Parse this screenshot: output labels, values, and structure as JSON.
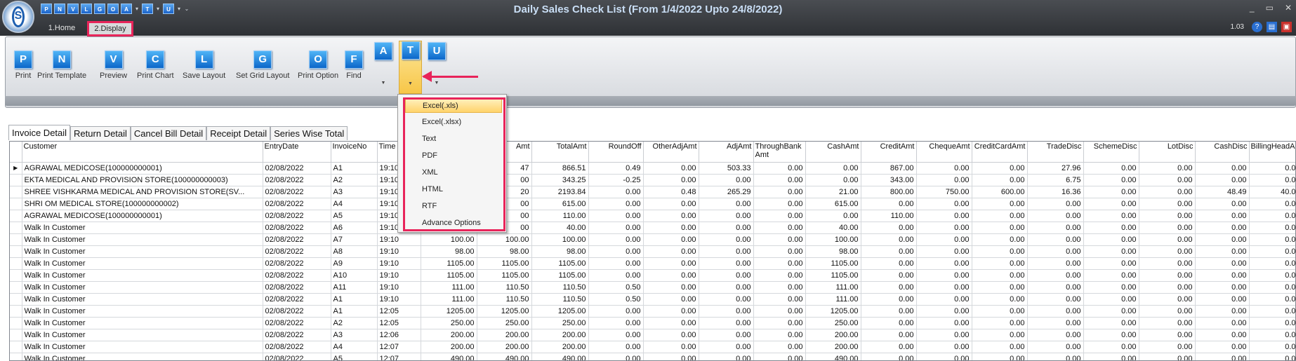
{
  "window": {
    "title": "Daily Sales Check List (From 1/4/2022 Upto 24/8/2022)",
    "version": "1.03",
    "controls": [
      "_",
      "▭",
      "✕"
    ]
  },
  "quick_access": [
    "P",
    "N",
    "V",
    "L",
    "G",
    "O",
    "A",
    "T",
    "U"
  ],
  "ribbon_tabs": [
    {
      "label": "1.Home"
    },
    {
      "label": "2.Display"
    }
  ],
  "ribbon_buttons": [
    {
      "glyph": "P",
      "label": "Print"
    },
    {
      "glyph": "N",
      "label": "Print Template"
    },
    {
      "glyph": "V",
      "label": "Preview"
    },
    {
      "glyph": "C",
      "label": "Print Chart"
    },
    {
      "glyph": "L",
      "label": "Save Layout"
    },
    {
      "glyph": "G",
      "label": "Set Grid Layout"
    },
    {
      "glyph": "O",
      "label": "Print Option"
    },
    {
      "glyph": "F",
      "label": "Find"
    }
  ],
  "split_buttons": [
    {
      "glyph": "A"
    },
    {
      "glyph": "T"
    },
    {
      "glyph": "U"
    }
  ],
  "export_menu": {
    "items": [
      "Excel(.xls)",
      "Excel(.xlsx)",
      "Text",
      "PDF",
      "XML",
      "HTML",
      "RTF",
      "Advance Options"
    ],
    "active": "Excel(.xls)"
  },
  "detail_tabs": [
    "Invoice Detail",
    "Return Detail",
    "Cancel Bill Detail",
    "Receipt Detail",
    "Series Wise Total"
  ],
  "columns": [
    "",
    "Customer",
    "EntryDate",
    "InvoiceNo",
    "Time",
    "",
    "Amt",
    "TotalAmt",
    "RoundOff",
    "OtherAdjAmt",
    "AdjAmt",
    "ThroughBank Amt",
    "CashAmt",
    "CreditAmt",
    "ChequeAmt",
    "CreditCardAmt",
    "TradeDisc",
    "SchemeDisc",
    "LotDisc",
    "CashDisc",
    "BillingHeadAr"
  ],
  "rows": [
    [
      "▶",
      "AGRAWAL MEDICOSE(100000000001)",
      "02/08/2022",
      "A1",
      "19:10",
      "",
      "47",
      "866.51",
      "0.49",
      "0.00",
      "503.33",
      "0.00",
      "0.00",
      "867.00",
      "0.00",
      "0.00",
      "27.96",
      "0.00",
      "0.00",
      "0.00",
      "0.0"
    ],
    [
      "",
      "EKTA MEDICAL AND PROVISION STORE(100000000003)",
      "02/08/2022",
      "A2",
      "19:10",
      "",
      "00",
      "343.25",
      "-0.25",
      "0.00",
      "0.00",
      "0.00",
      "0.00",
      "343.00",
      "0.00",
      "0.00",
      "6.75",
      "0.00",
      "0.00",
      "0.00",
      "0.0"
    ],
    [
      "",
      "SHREE VISHKARMA MEDICAL AND PROVISION STORE(SV...",
      "02/08/2022",
      "A3",
      "19:10",
      "",
      "20",
      "2193.84",
      "0.00",
      "0.48",
      "265.29",
      "0.00",
      "21.00",
      "800.00",
      "750.00",
      "600.00",
      "16.36",
      "0.00",
      "0.00",
      "48.49",
      "40.0"
    ],
    [
      "",
      "SHRI OM MEDICAL STORE(100000000002)",
      "02/08/2022",
      "A4",
      "19:10",
      "",
      "00",
      "615.00",
      "0.00",
      "0.00",
      "0.00",
      "0.00",
      "615.00",
      "0.00",
      "0.00",
      "0.00",
      "0.00",
      "0.00",
      "0.00",
      "0.00",
      "0.0"
    ],
    [
      "",
      "AGRAWAL MEDICOSE(100000000001)",
      "02/08/2022",
      "A5",
      "19:10",
      "",
      "00",
      "110.00",
      "0.00",
      "0.00",
      "0.00",
      "0.00",
      "0.00",
      "110.00",
      "0.00",
      "0.00",
      "0.00",
      "0.00",
      "0.00",
      "0.00",
      "0.0"
    ],
    [
      "",
      "Walk In Customer",
      "02/08/2022",
      "A6",
      "19:10",
      "",
      "00",
      "40.00",
      "0.00",
      "0.00",
      "0.00",
      "0.00",
      "40.00",
      "0.00",
      "0.00",
      "0.00",
      "0.00",
      "0.00",
      "0.00",
      "0.00",
      "0.0"
    ],
    [
      "",
      "Walk In Customer",
      "02/08/2022",
      "A7",
      "19:10",
      "100.00",
      "100.00",
      "100.00",
      "0.00",
      "0.00",
      "0.00",
      "0.00",
      "100.00",
      "0.00",
      "0.00",
      "0.00",
      "0.00",
      "0.00",
      "0.00",
      "0.00",
      "0.0"
    ],
    [
      "",
      "Walk In Customer",
      "02/08/2022",
      "A8",
      "19:10",
      "98.00",
      "98.00",
      "98.00",
      "0.00",
      "0.00",
      "0.00",
      "0.00",
      "98.00",
      "0.00",
      "0.00",
      "0.00",
      "0.00",
      "0.00",
      "0.00",
      "0.00",
      "0.0"
    ],
    [
      "",
      "Walk In Customer",
      "02/08/2022",
      "A9",
      "19:10",
      "1105.00",
      "1105.00",
      "1105.00",
      "0.00",
      "0.00",
      "0.00",
      "0.00",
      "1105.00",
      "0.00",
      "0.00",
      "0.00",
      "0.00",
      "0.00",
      "0.00",
      "0.00",
      "0.0"
    ],
    [
      "",
      "Walk In Customer",
      "02/08/2022",
      "A10",
      "19:10",
      "1105.00",
      "1105.00",
      "1105.00",
      "0.00",
      "0.00",
      "0.00",
      "0.00",
      "1105.00",
      "0.00",
      "0.00",
      "0.00",
      "0.00",
      "0.00",
      "0.00",
      "0.00",
      "0.0"
    ],
    [
      "",
      "Walk In Customer",
      "02/08/2022",
      "A11",
      "19:10",
      "111.00",
      "110.50",
      "110.50",
      "0.50",
      "0.00",
      "0.00",
      "0.00",
      "111.00",
      "0.00",
      "0.00",
      "0.00",
      "0.00",
      "0.00",
      "0.00",
      "0.00",
      "0.0"
    ],
    [
      "",
      "Walk In Customer",
      "02/08/2022",
      "A1",
      "19:10",
      "111.00",
      "110.50",
      "110.50",
      "0.50",
      "0.00",
      "0.00",
      "0.00",
      "111.00",
      "0.00",
      "0.00",
      "0.00",
      "0.00",
      "0.00",
      "0.00",
      "0.00",
      "0.0"
    ],
    [
      "",
      "Walk In Customer",
      "02/08/2022",
      "A1",
      "12:05",
      "1205.00",
      "1205.00",
      "1205.00",
      "0.00",
      "0.00",
      "0.00",
      "0.00",
      "1205.00",
      "0.00",
      "0.00",
      "0.00",
      "0.00",
      "0.00",
      "0.00",
      "0.00",
      "0.0"
    ],
    [
      "",
      "Walk In Customer",
      "02/08/2022",
      "A2",
      "12:05",
      "250.00",
      "250.00",
      "250.00",
      "0.00",
      "0.00",
      "0.00",
      "0.00",
      "250.00",
      "0.00",
      "0.00",
      "0.00",
      "0.00",
      "0.00",
      "0.00",
      "0.00",
      "0.0"
    ],
    [
      "",
      "Walk In Customer",
      "02/08/2022",
      "A3",
      "12:06",
      "200.00",
      "200.00",
      "200.00",
      "0.00",
      "0.00",
      "0.00",
      "0.00",
      "200.00",
      "0.00",
      "0.00",
      "0.00",
      "0.00",
      "0.00",
      "0.00",
      "0.00",
      "0.0"
    ],
    [
      "",
      "Walk In Customer",
      "02/08/2022",
      "A4",
      "12:07",
      "200.00",
      "200.00",
      "200.00",
      "0.00",
      "0.00",
      "0.00",
      "0.00",
      "200.00",
      "0.00",
      "0.00",
      "0.00",
      "0.00",
      "0.00",
      "0.00",
      "0.00",
      "0.0"
    ],
    [
      "",
      "Walk In Customer",
      "02/08/2022",
      "A5",
      "12:07",
      "490.00",
      "490.00",
      "490.00",
      "0.00",
      "0.00",
      "0.00",
      "0.00",
      "490.00",
      "0.00",
      "0.00",
      "0.00",
      "0.00",
      "0.00",
      "0.00",
      "0.00",
      "0.0"
    ]
  ]
}
